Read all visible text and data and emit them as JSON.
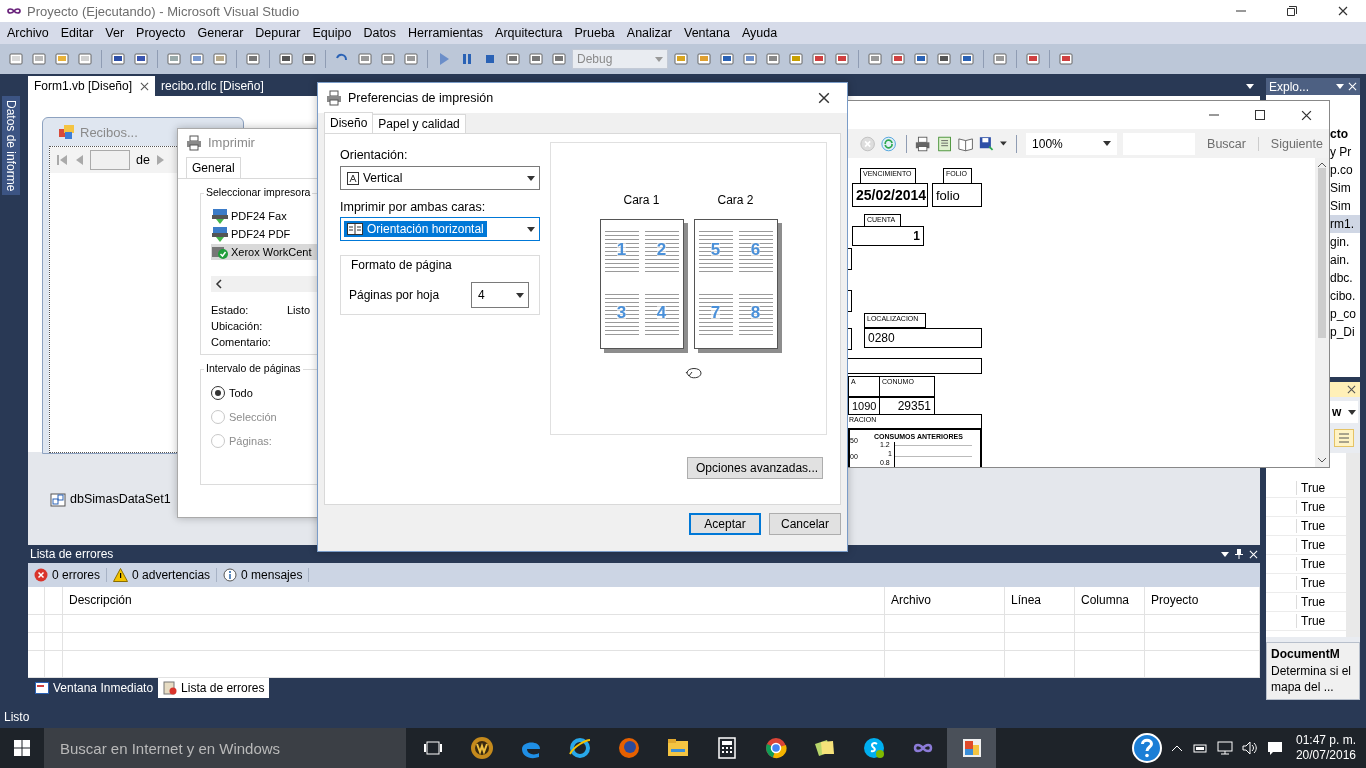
{
  "window": {
    "title": "Proyecto (Ejecutando) - Microsoft Visual Studio"
  },
  "menu": [
    "Archivo",
    "Editar",
    "Ver",
    "Proyecto",
    "Generar",
    "Depurar",
    "Equipo",
    "Datos",
    "Herramientas",
    "Arquitectura",
    "Prueba",
    "Analizar",
    "Ventana",
    "Ayuda"
  ],
  "toolbar": {
    "configuration": "Debug"
  },
  "side_tab": "Datos de informe",
  "document_tabs": [
    {
      "label": "Form1.vb [Diseño]",
      "selected": true
    },
    {
      "label": "recibo.rdlc [Diseño]",
      "selected": false
    }
  ],
  "designer": {
    "form_title": "Recibos...",
    "navigator_of": "de",
    "component": "dbSimasDataSet1"
  },
  "print_dialog": {
    "title": "Imprimir",
    "tabs": [
      {
        "label": "General",
        "selected": true
      }
    ],
    "printer_group": "Seleccionar impresora",
    "printers": [
      {
        "name": "PDF24 Fax",
        "kind": "printer",
        "selected": false
      },
      {
        "name": "PDF24 PDF",
        "kind": "printer",
        "selected": false
      },
      {
        "name": "Xerox WorkCent",
        "kind": "default",
        "selected": true
      }
    ],
    "details": [
      {
        "label": "Estado:",
        "value": "Listo"
      },
      {
        "label": "Ubicación:"
      },
      {
        "label": "Comentario:"
      }
    ],
    "range_group": "Intervalo de páginas",
    "range_options": [
      {
        "label": "Todo",
        "selected": true,
        "disabled": false
      },
      {
        "label": "Selección",
        "selected": false,
        "disabled": true
      },
      {
        "label": "Páginas:",
        "selected": false,
        "disabled": true
      }
    ]
  },
  "preferences_dialog": {
    "title": "Preferencias de impresión",
    "tabs": [
      {
        "label": "Diseño",
        "selected": true
      },
      {
        "label": "Papel y calidad",
        "selected": false
      }
    ],
    "orientation_label": "Orientación:",
    "orientation": "Vertical",
    "duplex_label": "Imprimir por ambas caras:",
    "duplex": "Orientación horizontal",
    "format_group": "Formato de página",
    "pages_per_sheet_label": "Páginas por hoja",
    "pages_per_sheet": "4",
    "preview": {
      "sides": [
        {
          "label": "Cara 1",
          "pages": [
            "1",
            "2",
            "3",
            "4"
          ]
        },
        {
          "label": "Cara 2",
          "pages": [
            "5",
            "6",
            "7",
            "8"
          ]
        }
      ]
    },
    "advanced_button": "Opciones avanzadas...",
    "buttons": [
      {
        "label": "Aceptar",
        "default": true
      },
      {
        "label": "Cancelar",
        "default": false
      }
    ]
  },
  "report_viewer": {
    "zoom": "100%",
    "find": "Buscar",
    "next": "Siguiente",
    "fields": [
      {
        "kind": "label",
        "text": "VENCIMIENTO"
      },
      {
        "kind": "label",
        "text": "FOLIO"
      },
      {
        "kind": "strong",
        "text": "25/02/2014"
      },
      {
        "kind": "value",
        "text": "folio"
      },
      {
        "kind": "label",
        "text": "CUENTA"
      },
      {
        "kind": "strong",
        "text": "1"
      },
      {
        "kind": "label",
        "text": "LOCALIZACION"
      },
      {
        "kind": "value",
        "text": "0280"
      },
      {
        "kind": "label",
        "text": "A"
      },
      {
        "kind": "label",
        "text": "CONUMO"
      },
      {
        "kind": "value",
        "text": "1090"
      },
      {
        "kind": "value",
        "text": "29351"
      },
      {
        "kind": "label",
        "text": "RACION"
      }
    ],
    "chart": {
      "title": "CONSUMOS ANTERIORES",
      "side_labels": [
        "50",
        "00"
      ],
      "ticks": [
        "1.2",
        "1",
        "0.8"
      ]
    }
  },
  "solution_explorer": {
    "title": "Explo...",
    "items": [
      {
        "label": "cto",
        "kind": "project",
        "selected": false
      },
      {
        "label": "y Pr",
        "kind": "file",
        "selected": false
      },
      {
        "label": "p.co",
        "kind": "file",
        "selected": false
      },
      {
        "label": "Sim",
        "kind": "file",
        "selected": false
      },
      {
        "label": "Sim",
        "kind": "file",
        "selected": false
      },
      {
        "label": "rm1.",
        "kind": "file",
        "selected": true
      },
      {
        "label": "gin.",
        "kind": "file",
        "selected": false
      },
      {
        "label": "ain.",
        "kind": "file",
        "selected": false
      },
      {
        "label": "dbc.",
        "kind": "file",
        "selected": false
      },
      {
        "label": "cibo.",
        "kind": "file",
        "selected": false
      },
      {
        "label": "p_co",
        "kind": "file",
        "selected": false
      },
      {
        "label": "p_Di",
        "kind": "file",
        "selected": false
      }
    ]
  },
  "properties": {
    "dropdown": "w",
    "values": [
      "True",
      "True",
      "True",
      "True",
      "True",
      "True",
      "True",
      "True"
    ],
    "description_title": "DocumentM",
    "description": "Determina si el mapa del ..."
  },
  "error_list": {
    "title": "Lista de errores",
    "filters": [
      {
        "kind": "error",
        "label": "0 errores"
      },
      {
        "kind": "warning",
        "label": "0 advertencias"
      },
      {
        "kind": "info",
        "label": "0 mensajes"
      }
    ],
    "columns": [
      "Descripción",
      "Archivo",
      "Línea",
      "Columna",
      "Proyecto"
    ]
  },
  "bottom_tabs": [
    {
      "label": "Ventana Inmediato",
      "selected": false
    },
    {
      "label": "Lista de errores",
      "selected": true
    }
  ],
  "status_bar": "Listo",
  "taskbar": {
    "search_placeholder": "Buscar en Internet y en Windows",
    "apps": [
      {
        "kind": "task-view",
        "active": false
      },
      {
        "kind": "game",
        "active": false
      },
      {
        "kind": "edge",
        "active": false
      },
      {
        "kind": "ie",
        "active": false
      },
      {
        "kind": "firefox",
        "active": false
      },
      {
        "kind": "explorer",
        "active": false
      },
      {
        "kind": "calculator",
        "active": false
      },
      {
        "kind": "chrome",
        "active": false
      },
      {
        "kind": "notes",
        "active": false
      },
      {
        "kind": "skype",
        "active": false
      },
      {
        "kind": "studio",
        "active": false
      },
      {
        "kind": "designer",
        "active": true
      }
    ],
    "time": "01:47 p. m.",
    "date": "20/07/2016"
  }
}
